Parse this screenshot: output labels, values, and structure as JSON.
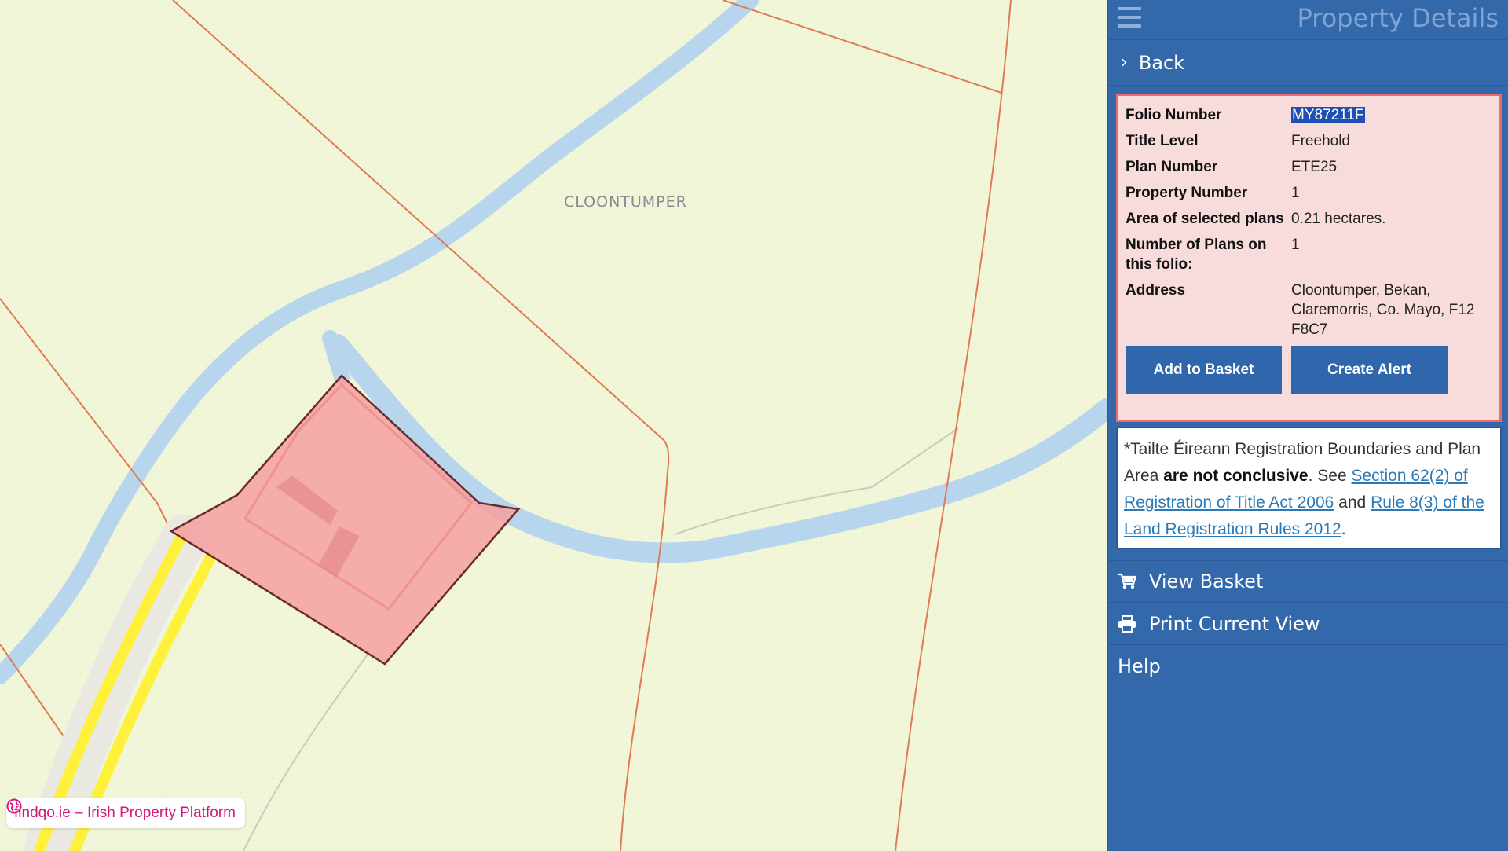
{
  "map": {
    "place_label": "CLOONTUMPER",
    "watermark": "findqo.ie – Irish Property Platform",
    "colors": {
      "background": "#f1f6d8",
      "boundary": "#e07a52",
      "water": "#cfe4f3",
      "parcel_fill": "#f4a0a0",
      "road": "#fff13a"
    }
  },
  "panel": {
    "title": "Property Details",
    "back_label": "Back",
    "details": {
      "rows": [
        {
          "label": "Folio Number",
          "value": "MY87211F"
        },
        {
          "label": "Title Level",
          "value": "Freehold"
        },
        {
          "label": "Plan Number",
          "value": "ETE25"
        },
        {
          "label": "Property Number",
          "value": "1"
        },
        {
          "label": "Area of selected plans",
          "value": "0.21 hectares."
        },
        {
          "label": "Number of Plans on this folio:",
          "value": "1"
        },
        {
          "label": "Address",
          "value": "Cloontumper, Bekan, Claremorris, Co. Mayo, F12 F8C7"
        }
      ],
      "add_to_basket": "Add to Basket",
      "create_alert": "Create Alert"
    },
    "notice": {
      "prefix": "*Tailte Éireann Registration Boundaries and Plan Area",
      "bold": "are not conclusive",
      "see": ". See",
      "link1": "Section 62(2) of Registration of Title Act 2006",
      "and": "and",
      "link2": "Rule 8(3) of the Land Registration Rules 2012",
      "end": "."
    },
    "view_basket": "View Basket",
    "print_view": "Print Current View",
    "help": "Help"
  }
}
